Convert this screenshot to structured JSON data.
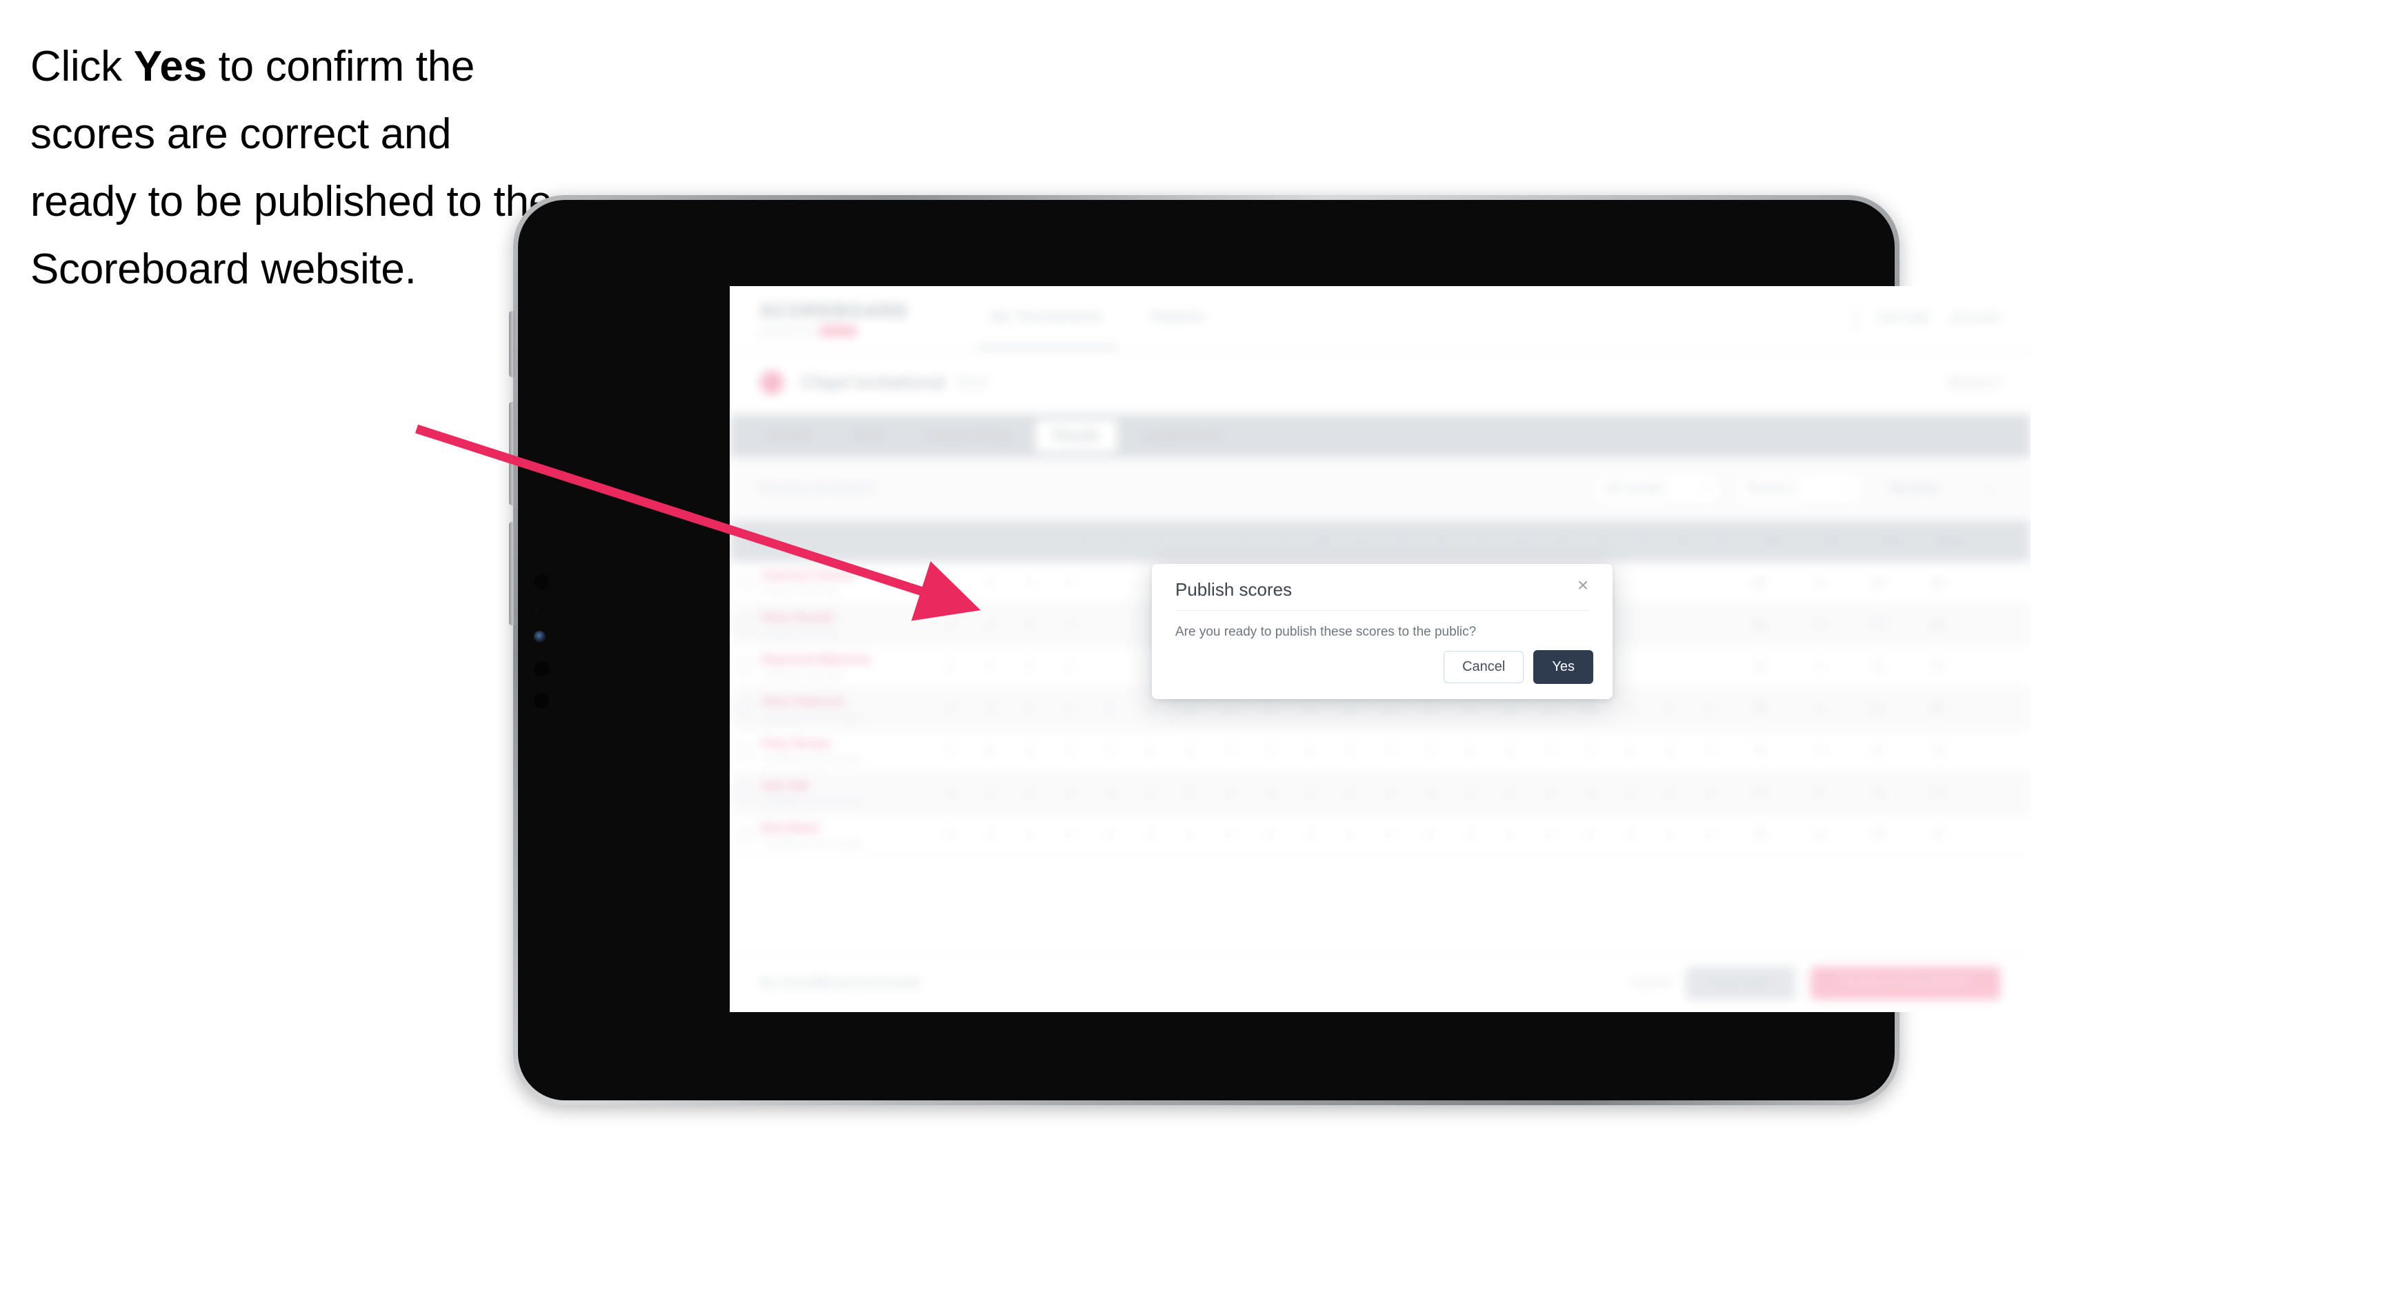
{
  "instruction": {
    "before": "Click ",
    "bold": "Yes",
    "after": " to confirm the scores are correct and ready to be published to the Scoreboard website."
  },
  "colors": {
    "arrow": "#ea2a5f",
    "modal_primary_button": "#2f3c4f",
    "brand_pink": "#f6b9cb",
    "device_bezel": "#0a0a0a"
  },
  "app": {
    "brand": {
      "word": "SCOREBOARD",
      "sub": "powered by",
      "pill": "golf"
    },
    "top_nav": [
      {
        "label": "My Tournaments",
        "active": true
      },
      {
        "label": "Reports",
        "active": false
      }
    ],
    "header_right": [
      {
        "label": "Get help"
      },
      {
        "label": "Account"
      }
    ],
    "tournament": {
      "name": "Clapd Invitational",
      "meta": "2024",
      "right": "Round 2"
    },
    "tabs": [
      {
        "label": "Details",
        "active": false
      },
      {
        "label": "Field",
        "active": false
      },
      {
        "label": "Course Setup",
        "active": false
      },
      {
        "label": "Results",
        "active": true
      },
      {
        "label": "Leaderboard",
        "active": false
      }
    ],
    "filters": {
      "left_note": "Showing all players",
      "controls": [
        {
          "label": "All rounds",
          "type": "select"
        },
        {
          "label": "Round 2",
          "type": "select"
        },
        {
          "label": "Tee time",
          "type": "select"
        }
      ]
    },
    "table": {
      "columns": [
        "Player",
        "1",
        "2",
        "3",
        "4",
        "5",
        "6",
        "7",
        "8",
        "9",
        "Out",
        "10",
        "11",
        "12",
        "13",
        "14",
        "15",
        "16",
        "17",
        "18",
        "In",
        "Total",
        "Par",
        "Score",
        "Status"
      ],
      "rows": [
        {
          "name": "Cameron Gomez",
          "club": "Phoenix Golf Club",
          "scores": [
            "4",
            "5",
            "3",
            "4",
            "",
            "",
            "",
            "",
            "",
            "",
            "",
            "",
            "",
            "",
            "",
            "",
            "",
            "",
            "",
            ""
          ],
          "total": "68",
          "par": "-4",
          "score": "68",
          "status": "68"
        },
        {
          "name": "Peter Pursell",
          "club": "Oxleigh Golf Club",
          "scores": [
            "4",
            "4",
            "4",
            "3",
            "",
            "",
            "",
            "",
            "",
            "",
            "",
            "",
            "",
            "",
            "",
            "",
            "",
            "",
            "",
            ""
          ],
          "total": "69",
          "par": "-3",
          "score": "70",
          "status": "69"
        },
        {
          "name": "Raymond Waterson",
          "club": "Lakeview Golf Club",
          "scores": [
            "3",
            "4",
            "5",
            "4",
            "",
            "",
            "",
            "",
            "",
            "",
            "",
            "",
            "",
            "",
            "",
            "",
            "",
            "",
            "",
            ""
          ],
          "total": "70",
          "par": "-2",
          "score": "71",
          "status": "70"
        },
        {
          "name": "Chris Paterson",
          "club": "Sandfields Golf Society",
          "scores": [
            "4",
            "4",
            "3",
            "4",
            "5",
            "4",
            "4",
            "4",
            "3",
            "4",
            "4",
            "4",
            "3",
            "4",
            "4",
            "4",
            "4",
            "4",
            "4",
            "4"
          ],
          "total": "68",
          "par": "-4",
          "score": "67",
          "status": "68"
        },
        {
          "name": "Peter Brown",
          "club": "Sandfields Golf Society",
          "scores": [
            "4",
            "5",
            "4",
            "3",
            "4",
            "4",
            "4",
            "4",
            "4",
            "4",
            "3",
            "4",
            "4",
            "4",
            "4",
            "4",
            "4",
            "4",
            "4",
            "4"
          ],
          "total": "71",
          "par": "-1",
          "score": "72",
          "status": "71"
        },
        {
          "name": "Sam Hill",
          "club": "Sandfields Golf Society",
          "scores": [
            "4",
            "4",
            "4",
            "4",
            "4",
            "4",
            "5",
            "4",
            "4",
            "4",
            "4",
            "4",
            "4",
            "4",
            "3",
            "4",
            "4",
            "4",
            "4",
            "4"
          ],
          "total": "72",
          "par": "E",
          "score": "72",
          "status": "72"
        },
        {
          "name": "Bob Baker",
          "club": "Sandfields Golf Society",
          "scores": [
            "5",
            "4",
            "4",
            "4",
            "4",
            "4",
            "4",
            "4",
            "4",
            "4",
            "4",
            "4",
            "4",
            "4",
            "4",
            "4",
            "4",
            "4",
            "4",
            "4"
          ],
          "total": "73",
          "par": "+1",
          "score": "73",
          "status": "73"
        }
      ]
    },
    "action_bar": {
      "note": "No unconfirmed scorecards",
      "link": "Cancel",
      "secondary_button": "Save draft",
      "primary_button": "Publish to Scoreboard"
    }
  },
  "modal": {
    "title": "Publish scores",
    "body": "Are you ready to publish these scores to the public?",
    "close_icon": "×",
    "cancel_label": "Cancel",
    "confirm_label": "Yes"
  }
}
